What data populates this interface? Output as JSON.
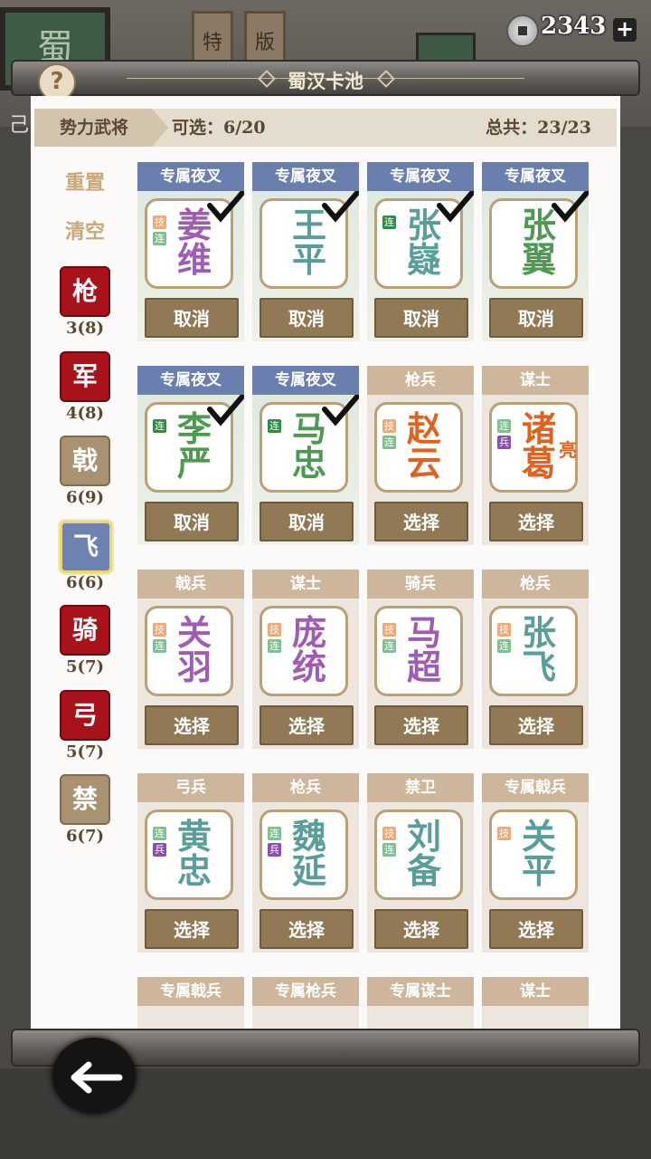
{
  "background": {
    "sign_char": "蜀",
    "tabs": [
      "特",
      "版"
    ],
    "left_text": "己",
    "coins": "2343"
  },
  "header": {
    "title": "蜀汉卡池",
    "help_label": "?"
  },
  "filter": {
    "faction_label": "势力武将",
    "selectable": "可选：6/20",
    "total": "总共：23/23"
  },
  "sidebar": {
    "reset": "重置",
    "clear": "清空",
    "types": [
      {
        "char": "枪",
        "count": "3(8)",
        "style": "red"
      },
      {
        "char": "军",
        "count": "4(8)",
        "style": "red"
      },
      {
        "char": "戟",
        "count": "6(9)",
        "style": "brown"
      },
      {
        "char": "飞",
        "count": "6(6)",
        "style": "blue"
      },
      {
        "char": "骑",
        "count": "5(7)",
        "style": "red"
      },
      {
        "char": "弓",
        "count": "5(7)",
        "style": "red"
      },
      {
        "char": "禁",
        "count": "6(7)",
        "style": "brown"
      }
    ]
  },
  "cards": [
    {
      "header": "专属夜叉",
      "name1": "姜",
      "name2": "维",
      "extra": "",
      "color": "#a05bb5",
      "badges": [
        "技",
        "连"
      ],
      "selected": true,
      "action": "取消"
    },
    {
      "header": "专属夜叉",
      "name1": "王",
      "name2": "平",
      "extra": "",
      "color": "#5a9e9b",
      "badges": [],
      "selected": true,
      "action": "取消"
    },
    {
      "header": "专属夜叉",
      "name1": "张",
      "name2": "嶷",
      "extra": "",
      "color": "#5a9e9b",
      "badges": [
        "连"
      ],
      "selected": true,
      "action": "取消"
    },
    {
      "header": "专属夜叉",
      "name1": "张",
      "name2": "翼",
      "extra": "",
      "color": "#4e9a52",
      "badges": [],
      "selected": true,
      "action": "取消"
    },
    {
      "header": "专属夜叉",
      "name1": "李",
      "name2": "严",
      "extra": "",
      "color": "#4e9a52",
      "badges": [
        "连"
      ],
      "selected": true,
      "action": "取消"
    },
    {
      "header": "专属夜叉",
      "name1": "马",
      "name2": "忠",
      "extra": "",
      "color": "#4e9a52",
      "badges": [
        "连"
      ],
      "selected": true,
      "action": "取消"
    },
    {
      "header": "枪兵",
      "name1": "赵",
      "name2": "云",
      "extra": "",
      "color": "#e0621f",
      "badges": [
        "技",
        "连"
      ],
      "selected": false,
      "action": "选择"
    },
    {
      "header": "谋士",
      "name1": "诸",
      "name2": "葛",
      "extra": "亮",
      "color": "#e0621f",
      "badges": [
        "连",
        "兵"
      ],
      "selected": false,
      "action": "选择"
    },
    {
      "header": "戟兵",
      "name1": "关",
      "name2": "羽",
      "extra": "",
      "color": "#a05bb5",
      "badges": [
        "技",
        "连"
      ],
      "selected": false,
      "action": "选择"
    },
    {
      "header": "谋士",
      "name1": "庞",
      "name2": "统",
      "extra": "",
      "color": "#a05bb5",
      "badges": [
        "技",
        "连"
      ],
      "selected": false,
      "action": "选择"
    },
    {
      "header": "骑兵",
      "name1": "马",
      "name2": "超",
      "extra": "",
      "color": "#a05bb5",
      "badges": [
        "技",
        "连"
      ],
      "selected": false,
      "action": "选择"
    },
    {
      "header": "枪兵",
      "name1": "张",
      "name2": "飞",
      "extra": "",
      "color": "#5a9e9b",
      "badges": [
        "技",
        "连"
      ],
      "selected": false,
      "action": "选择"
    },
    {
      "header": "弓兵",
      "name1": "黄",
      "name2": "忠",
      "extra": "",
      "color": "#5a9e9b",
      "badges": [
        "连",
        "兵"
      ],
      "selected": false,
      "action": "选择"
    },
    {
      "header": "枪兵",
      "name1": "魏",
      "name2": "延",
      "extra": "",
      "color": "#5a9e9b",
      "badges": [
        "连",
        "兵"
      ],
      "selected": false,
      "action": "选择"
    },
    {
      "header": "禁卫",
      "name1": "刘",
      "name2": "备",
      "extra": "",
      "color": "#5a9e9b",
      "badges": [
        "技",
        "连"
      ],
      "selected": false,
      "action": "选择"
    },
    {
      "header": "专属戟兵",
      "name1": "关",
      "name2": "平",
      "extra": "",
      "color": "#5a9e9b",
      "badges": [
        "技"
      ],
      "selected": false,
      "action": "选择"
    },
    {
      "header": "专属戟兵",
      "name1": "",
      "name2": "",
      "extra": "",
      "color": "#5a9e9b",
      "badges": [],
      "selected": false,
      "action": ""
    },
    {
      "header": "专属枪兵",
      "name1": "",
      "name2": "",
      "extra": "",
      "color": "#5a9e9b",
      "badges": [],
      "selected": false,
      "action": ""
    },
    {
      "header": "专属谋士",
      "name1": "",
      "name2": "",
      "extra": "",
      "color": "#5a9e9b",
      "badges": [],
      "selected": false,
      "action": ""
    },
    {
      "header": "谋士",
      "name1": "",
      "name2": "",
      "extra": "",
      "color": "#5a9e9b",
      "badges": [],
      "selected": false,
      "action": ""
    }
  ]
}
